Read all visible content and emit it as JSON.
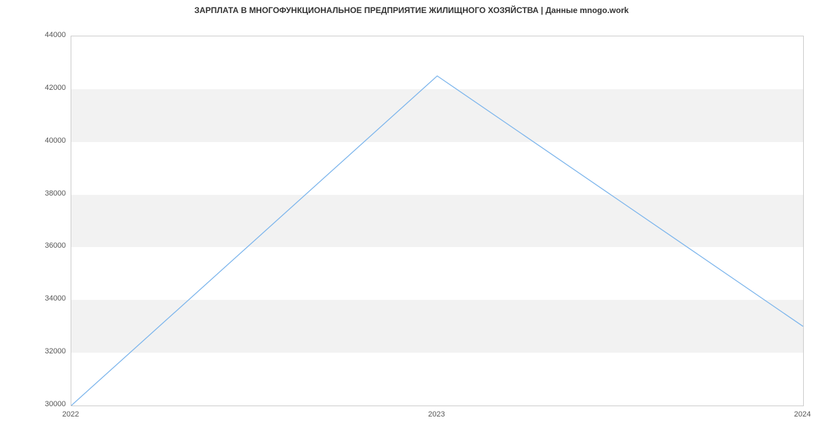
{
  "chart_data": {
    "type": "line",
    "title": "ЗАРПЛАТА В МНОГОФУНКЦИОНАЛЬНОЕ ПРЕДПРИЯТИЕ ЖИЛИЩНОГО ХОЗЯЙСТВА | Данные mnogo.work",
    "x": [
      2022,
      2023,
      2024
    ],
    "values": [
      30000,
      42500,
      33000
    ],
    "xlabel": "",
    "ylabel": "",
    "ylim": [
      30000,
      44000
    ],
    "y_ticks": [
      30000,
      32000,
      34000,
      36000,
      38000,
      40000,
      42000,
      44000
    ],
    "x_ticks": [
      2022,
      2023,
      2024
    ]
  }
}
